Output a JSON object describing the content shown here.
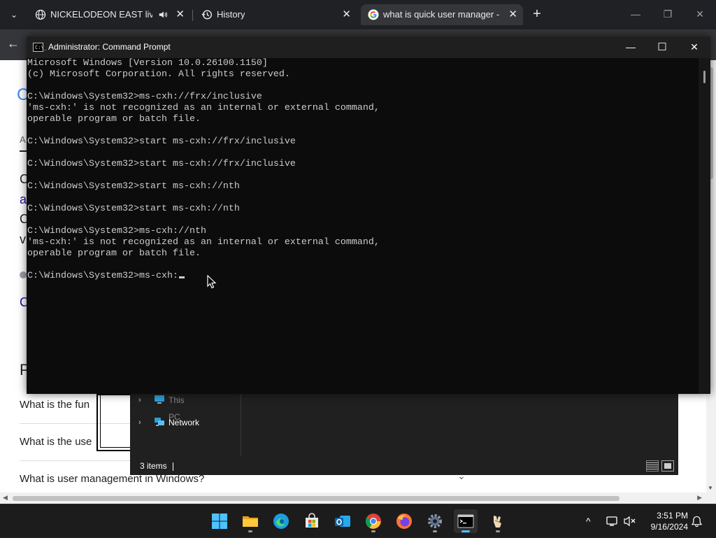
{
  "browser": {
    "tabs": [
      {
        "title": "NICKELODEON EAST live st",
        "icon": "globe-icon",
        "audio": true,
        "active": false
      },
      {
        "title": "History",
        "icon": "history-icon",
        "active": false
      },
      {
        "title": "what is quick user manager - G",
        "icon": "google-icon",
        "active": true
      }
    ],
    "new_tab_symbol": "+",
    "tab_close_symbol": "✕",
    "tab_dropdown_symbol": "⌄",
    "back_symbol": "←",
    "window_controls": {
      "minimize": "—",
      "restore": "❐",
      "close": "✕"
    }
  },
  "webpage": {
    "peek_letters": [
      "C",
      "A",
      "C",
      "a",
      "C",
      "v",
      "C",
      "P"
    ],
    "people_also_ask": [
      {
        "question": "What is the fun",
        "chevron": "⌄"
      },
      {
        "question": "What is the use",
        "chevron": "⌄"
      },
      {
        "question": "What is user management in Windows?",
        "chevron": "⌄"
      }
    ]
  },
  "file_explorer": {
    "nav_items": [
      {
        "label": "This PC",
        "icon": "computer-icon"
      },
      {
        "label": "Network",
        "icon": "network-icon"
      }
    ],
    "status_count": "3 items"
  },
  "cmd": {
    "title": "Administrator: Command Prompt",
    "icon_text": "C:\\_",
    "window_controls": {
      "minimize": "—",
      "maximize": "☐",
      "close": "✕"
    },
    "lines": [
      "Microsoft Windows [Version 10.0.26100.1150]",
      "(c) Microsoft Corporation. All rights reserved.",
      "",
      "C:\\Windows\\System32>ms-cxh://frx/inclusive",
      "'ms-cxh:' is not recognized as an internal or external command,",
      "operable program or batch file.",
      "",
      "C:\\Windows\\System32>start ms-cxh://frx/inclusive",
      "",
      "C:\\Windows\\System32>start ms-cxh://frx/inclusive",
      "",
      "C:\\Windows\\System32>start ms-cxh://nth",
      "",
      "C:\\Windows\\System32>start ms-cxh://nth",
      "",
      "C:\\Windows\\System32>ms-cxh://nth",
      "'ms-cxh:' is not recognized as an internal or external command,",
      "operable program or batch file.",
      ""
    ],
    "current_prompt": "C:\\Windows\\System32>ms-cxh:"
  },
  "taskbar": {
    "apps": [
      {
        "name": "start-button",
        "icon": "windows-logo-icon"
      },
      {
        "name": "file-explorer",
        "icon": "folder-icon"
      },
      {
        "name": "edge",
        "icon": "edge-icon"
      },
      {
        "name": "store",
        "icon": "store-icon"
      },
      {
        "name": "outlook",
        "icon": "outlook-icon"
      },
      {
        "name": "chrome",
        "icon": "chrome-icon"
      },
      {
        "name": "firefox",
        "icon": "firefox-icon"
      },
      {
        "name": "settings",
        "icon": "gear-icon"
      },
      {
        "name": "terminal",
        "icon": "terminal-icon"
      },
      {
        "name": "app",
        "icon": "app-icon"
      }
    ],
    "tray": {
      "chevron": "^"
    },
    "clock": {
      "time": "3:51 PM",
      "date": "9/16/2024"
    }
  },
  "colors": {
    "chrome_dark": "#202124",
    "cmd_bg": "#0c0c0c",
    "cmd_text": "#cccccc",
    "taskbar": "#1c1c1c",
    "accent": "#4cc2ff"
  }
}
